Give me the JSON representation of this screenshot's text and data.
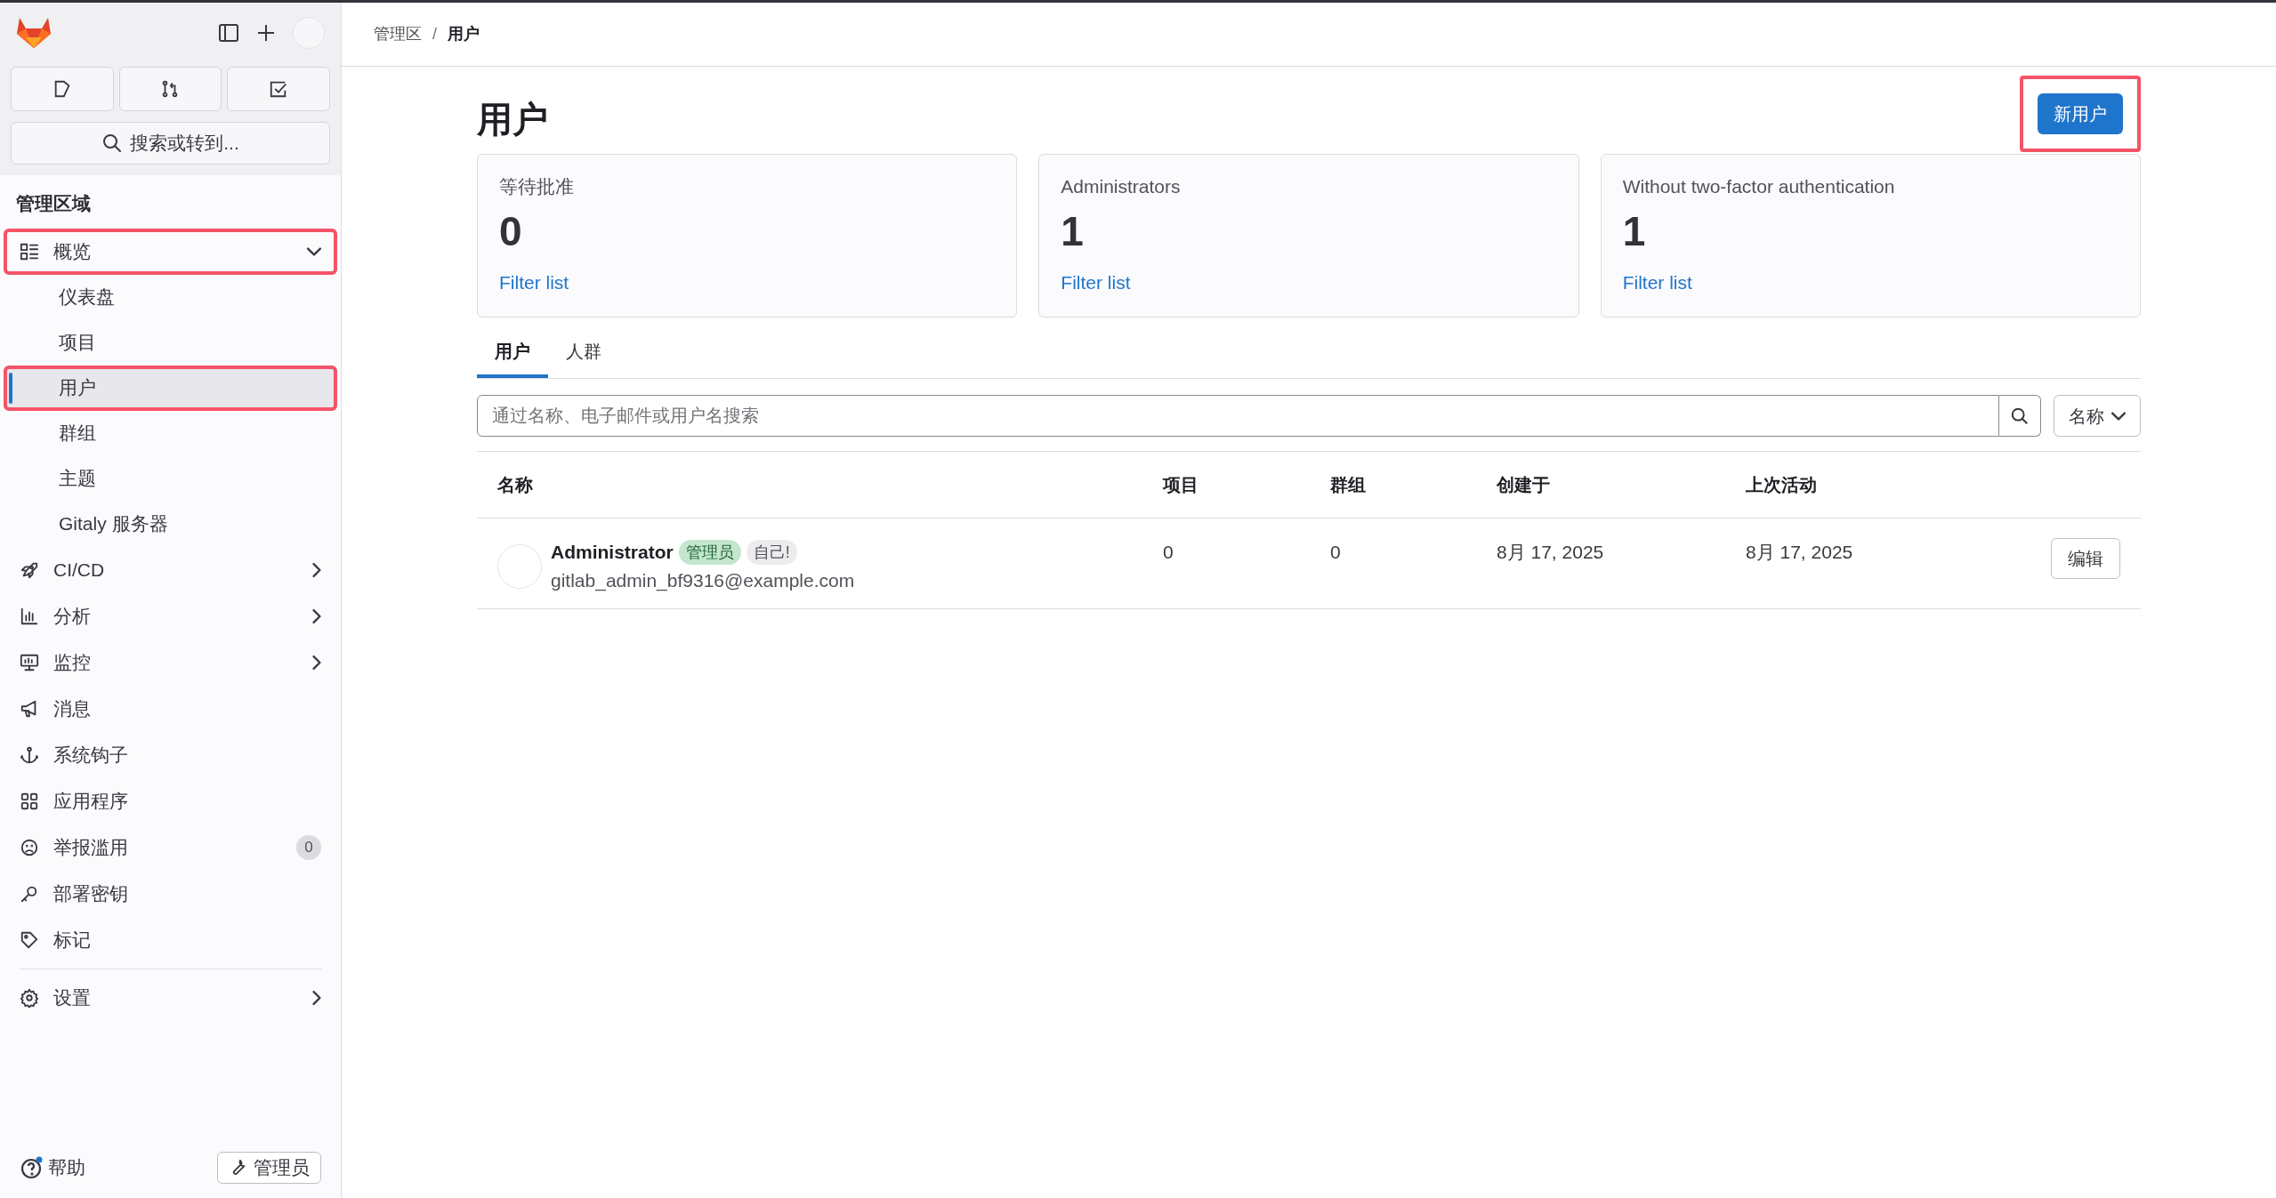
{
  "sidebar": {
    "search_button": "搜索或转到...",
    "section_title": "管理区域",
    "nav": [
      {
        "label": "概览",
        "expanded": true,
        "highlighted": true,
        "children": [
          {
            "label": "仪表盘",
            "selected": false,
            "highlighted": false
          },
          {
            "label": "项目",
            "selected": false,
            "highlighted": false
          },
          {
            "label": "用户",
            "selected": true,
            "highlighted": true
          },
          {
            "label": "群组",
            "selected": false,
            "highlighted": false
          },
          {
            "label": "主题",
            "selected": false,
            "highlighted": false
          },
          {
            "label": "Gitaly 服务器",
            "selected": false,
            "highlighted": false
          }
        ]
      },
      {
        "label": "CI/CD",
        "expanded": false,
        "highlighted": false
      },
      {
        "label": "分析",
        "expanded": false,
        "highlighted": false
      },
      {
        "label": "监控",
        "expanded": false,
        "highlighted": false
      },
      {
        "label": "消息",
        "highlighted": false
      },
      {
        "label": "系统钩子",
        "highlighted": false
      },
      {
        "label": "应用程序",
        "highlighted": false
      },
      {
        "label": "举报滥用",
        "highlighted": false,
        "badge": "0"
      },
      {
        "label": "部署密钥",
        "highlighted": false
      },
      {
        "label": "标记",
        "highlighted": false
      }
    ],
    "bottom_nav": [
      {
        "label": "设置",
        "expanded": false,
        "highlighted": false
      }
    ],
    "help": "帮助",
    "admin_button": "管理员"
  },
  "breadcrumbs": {
    "separator": "/",
    "items": [
      {
        "label": "管理区",
        "current": false
      },
      {
        "label": "用户",
        "current": true
      }
    ]
  },
  "title": "用户",
  "new_user_button": {
    "label": "新用户",
    "highlighted": true
  },
  "stats": [
    {
      "label": "等待批准",
      "value": "0",
      "link": "Filter list"
    },
    {
      "label": "Administrators",
      "value": "1",
      "link": "Filter list"
    },
    {
      "label": "Without two-factor authentication",
      "value": "1",
      "link": "Filter list"
    }
  ],
  "tabs": [
    {
      "label": "用户",
      "selected": true
    },
    {
      "label": "人群",
      "selected": false
    }
  ],
  "search": {
    "placeholder": "通过名称、电子邮件或用户名搜索"
  },
  "sort_button": "名称",
  "table": {
    "columns": [
      "名称",
      "项目",
      "群组",
      "创建于",
      "上次活动"
    ],
    "rows": [
      {
        "name": "Administrator",
        "badges": [
          {
            "label": "管理员",
            "kind": "admin"
          },
          {
            "label": "自己!",
            "kind": "self"
          }
        ],
        "email": "gitlab_admin_bf9316@example.com",
        "projects": "0",
        "groups": "0",
        "created": "8月 17, 2025",
        "last_activity": "8月 17, 2025",
        "action": "编辑"
      }
    ]
  }
}
